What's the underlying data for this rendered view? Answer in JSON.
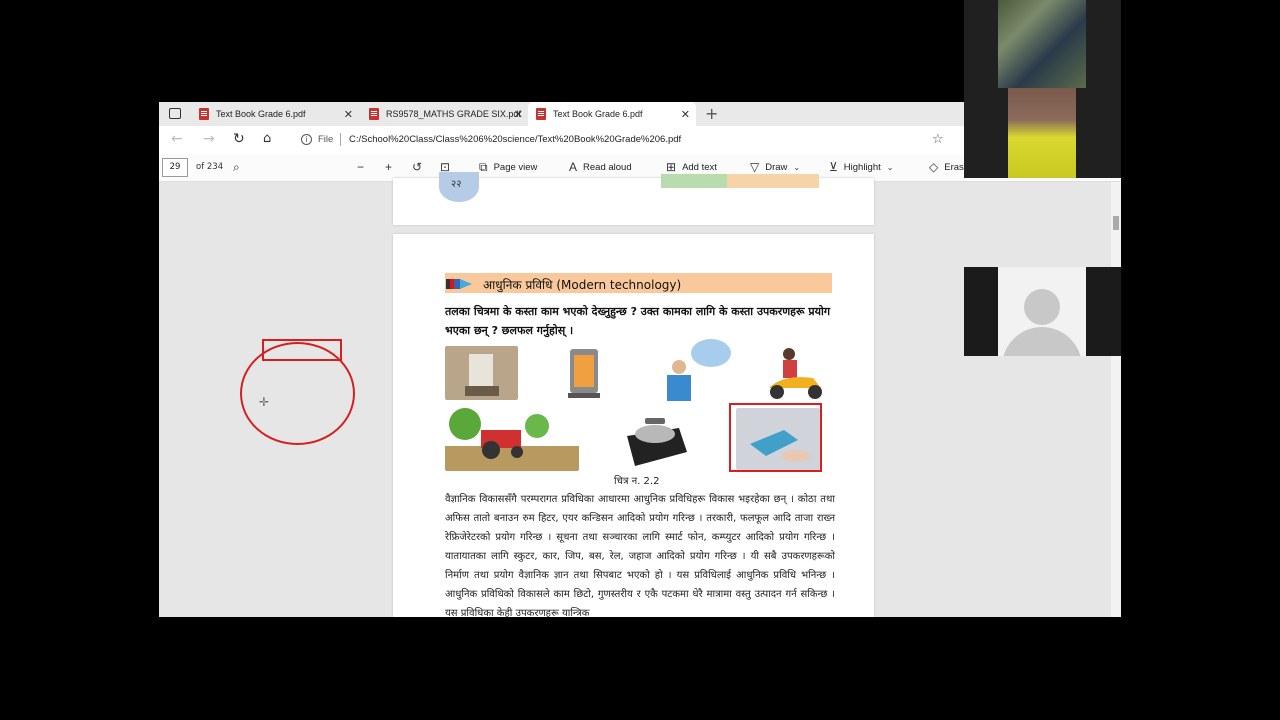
{
  "tabs": [
    {
      "label": "Text Book Grade 6.pdf",
      "active": false
    },
    {
      "label": "RS9578_MATHS GRADE SIX.pdf",
      "active": false
    },
    {
      "label": "Text Book Grade 6.pdf",
      "active": true
    }
  ],
  "address": {
    "file_label": "File",
    "url": "C:/School%20Class/Class%206%20science/Text%20Book%20Grade%206.pdf"
  },
  "toolbar": {
    "page_number": "29",
    "page_total": "of 234",
    "page_view": "Page view",
    "read_aloud": "Read aloud",
    "add_text": "Add text",
    "draw": "Draw",
    "highlight": "Highlight",
    "erase": "Eras"
  },
  "page": {
    "prev_page_num": "२२",
    "section_title": "आधुनिक प्रविधि (Modern technology)",
    "question": "तलका चित्रमा के कस्ता काम भएको देख्नुहुन्छ ? उक्त कामका लागि के कस्ता उपकरणहरू प्रयोग भएका छन् ? छलफल गर्नुहोस् ।",
    "caption": "चित्र न. 2.2",
    "body": "वैज्ञानिक विकाससँगै परम्परागत प्रविधिका आधारमा आधुनिक प्रविधिहरू विकास भइरहेका छन् । कोठा तथा अफिस तातो बनाउन रुम हिटर, एयर कन्डिसन आदिको प्रयोग गरिन्छ । तरकारी, फलफूल आदि ताजा राख्न रेफ्रिजेरेटरको प्रयोग गरिन्छ । सूचना तथा सञ्चारका लागि स्मार्ट फोन, कम्प्युटर आदिको प्रयोग गरिन्छ । यातायातका लागि स्कुटर, कार, जिप, बस, रेल, जहाज आदिको प्रयोग गरिन्छ । यी सबै उपकरणहरूको निर्माण तथा प्रयोग वैज्ञानिक ज्ञान तथा सिपबाट भएको हो । यस प्रविधिलाई आधुनिक प्रविधि भनिन्छ । आधुनिक प्रविधिको विकासले काम छिटो, गुणस्तरीय र एकै पटकमा धेरै मात्रामा वस्तु उत्पादन गर्न सकिन्छ । यस प्रविधिका केही उपकरणहरू यान्त्रिक"
  },
  "colors": {
    "annotation": "#d62020",
    "section_bar": "#f9c99b",
    "pdf_icon": "#c8332f"
  }
}
